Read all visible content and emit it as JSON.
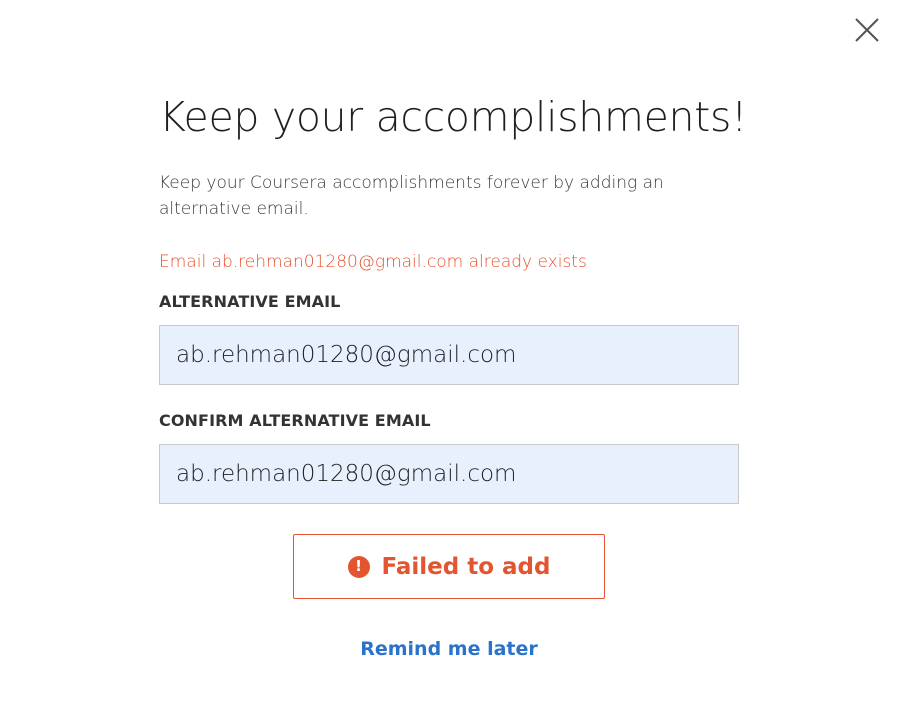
{
  "modal": {
    "title": "Keep your accomplishments!",
    "subtitle": "Keep your Coursera accomplishments forever by adding an alternative email.",
    "error_message": "Email ab.rehman01280@gmail.com already exists",
    "close_icon": "close-icon"
  },
  "form": {
    "alt_email_label": "ALTERNATIVE EMAIL",
    "alt_email_value": "ab.rehman01280@gmail.com",
    "confirm_email_label": "CONFIRM ALTERNATIVE EMAIL",
    "confirm_email_value": "ab.rehman01280@gmail.com"
  },
  "actions": {
    "status_button_label": "Failed to add",
    "status_icon": "alert-circle-icon",
    "status_icon_glyph": "!",
    "remind_label": "Remind me later"
  },
  "colors": {
    "error": "#e35430",
    "link": "#2a73cc",
    "input_bg": "#e8f0fe"
  }
}
